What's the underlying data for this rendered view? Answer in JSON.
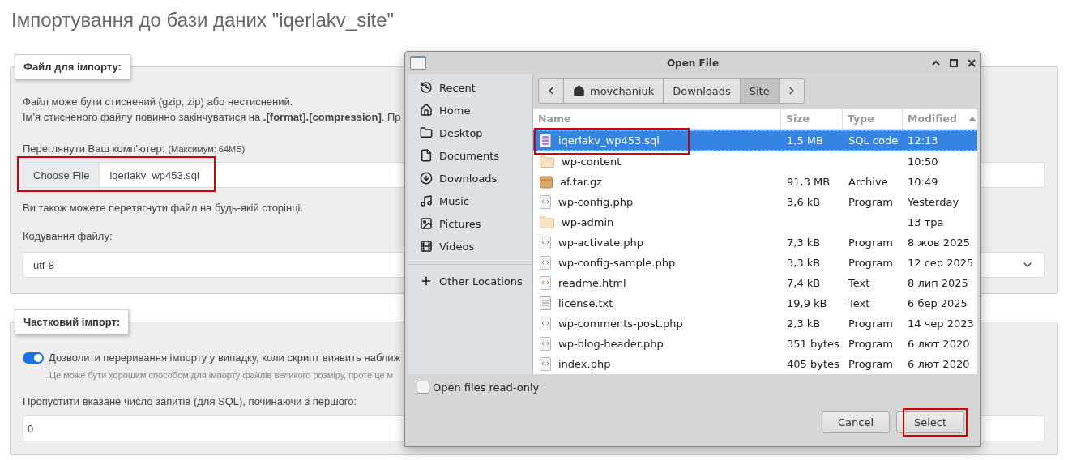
{
  "page_title": "Імпортування до бази даних \"iqerlakv_site\"",
  "file_section": {
    "legend": "Файл для імпорту:",
    "notes": [
      "Файл може бути стиснений (gzip, zip) або нестиснений.",
      "Ім'я стисненого файлу повинно закінчуватися на **.[format].[compression]**. Пр"
    ],
    "browse_label": "Переглянути Ваш комп'ютер:",
    "browse_limit": "(Максимум: 64МБ)",
    "choose_button": "Choose File",
    "chosen_file": "iqerlakv_wp453.sql",
    "highlighted": true,
    "drag_note": "Ви також можете перетягнути файл на будь-якій сторінці.",
    "encoding_label": "Кодування файлу:",
    "encoding_value": "utf-8"
  },
  "partial_section": {
    "legend": "Частковий імпорт:",
    "allow_interrupt": {
      "on": true,
      "label": "Дозволити переривання імпорту у випадку, коли скрипт виявить наближ",
      "hint": "Це може бути хорошим способом для імпорту файлів великого розміру, проте це м"
    },
    "skip_label": "Пропустити вказане число запитів (для SQL), починаючи з першого:",
    "skip_value": "0"
  },
  "dialog": {
    "title": "Open File",
    "places": [
      {
        "label": "Recent"
      },
      {
        "label": "Home"
      },
      {
        "label": "Desktop"
      },
      {
        "label": "Documents"
      },
      {
        "label": "Downloads"
      },
      {
        "label": "Music"
      },
      {
        "label": "Pictures"
      },
      {
        "label": "Videos"
      }
    ],
    "other_locations": "Other Locations",
    "path": [
      {
        "label": "movchaniuk",
        "home": true,
        "selected": false
      },
      {
        "label": "Downloads",
        "home": false,
        "selected": false
      },
      {
        "label": "Site",
        "home": false,
        "selected": true
      }
    ],
    "columns": [
      "Name",
      "Size",
      "Type",
      "Modified"
    ],
    "rows": [
      {
        "kind": "sql",
        "name": "iqerlakv_wp453.sql",
        "size": "1,5 MB",
        "type": "SQL code",
        "modified": "12:13",
        "selected": true,
        "highlighted": true
      },
      {
        "kind": "folder",
        "name": "wp-content",
        "modified": "10:50",
        "selected": false,
        "highlighted": false
      },
      {
        "kind": "archive",
        "name": "af.tar.gz",
        "size": "91,3 MB",
        "type": "Archive",
        "modified": "10:49",
        "selected": false,
        "highlighted": false
      },
      {
        "kind": "php",
        "name": "wp-config.php",
        "size": "3,6 kB",
        "type": "Program",
        "modified": "Yesterday",
        "selected": false,
        "highlighted": false
      },
      {
        "kind": "folder",
        "name": "wp-admin",
        "modified": "13 тра",
        "selected": false,
        "highlighted": false
      },
      {
        "kind": "php",
        "name": "wp-activate.php",
        "size": "7,3 kB",
        "type": "Program",
        "modified": "8 жов 2025",
        "selected": false,
        "highlighted": false
      },
      {
        "kind": "php",
        "name": "wp-config-sample.php",
        "size": "3,3 kB",
        "type": "Program",
        "modified": "12 сер 2025",
        "selected": false,
        "highlighted": false
      },
      {
        "kind": "html",
        "name": "readme.html",
        "size": "7,4 kB",
        "type": "Text",
        "modified": "8 лип 2025",
        "selected": false,
        "highlighted": false
      },
      {
        "kind": "text",
        "name": "license.txt",
        "size": "19,9 kB",
        "type": "Text",
        "modified": "6 бер 2025",
        "selected": false,
        "highlighted": false
      },
      {
        "kind": "php",
        "name": "wp-comments-post.php",
        "size": "2,3 kB",
        "type": "Program",
        "modified": "14 чер 2023",
        "selected": false,
        "highlighted": false
      },
      {
        "kind": "php",
        "name": "wp-blog-header.php",
        "size": "351 bytes",
        "type": "Program",
        "modified": "6 лют 2020",
        "selected": false,
        "highlighted": false
      },
      {
        "kind": "php",
        "name": "index.php",
        "size": "405 bytes",
        "type": "Program",
        "modified": "6 лют 2020",
        "selected": false,
        "highlighted": false
      }
    ],
    "read_only": {
      "label": "Open files read-only",
      "checked": false
    },
    "buttons": [
      {
        "label": "Cancel",
        "highlighted": false
      },
      {
        "label": "Select",
        "highlighted": true
      }
    ]
  }
}
